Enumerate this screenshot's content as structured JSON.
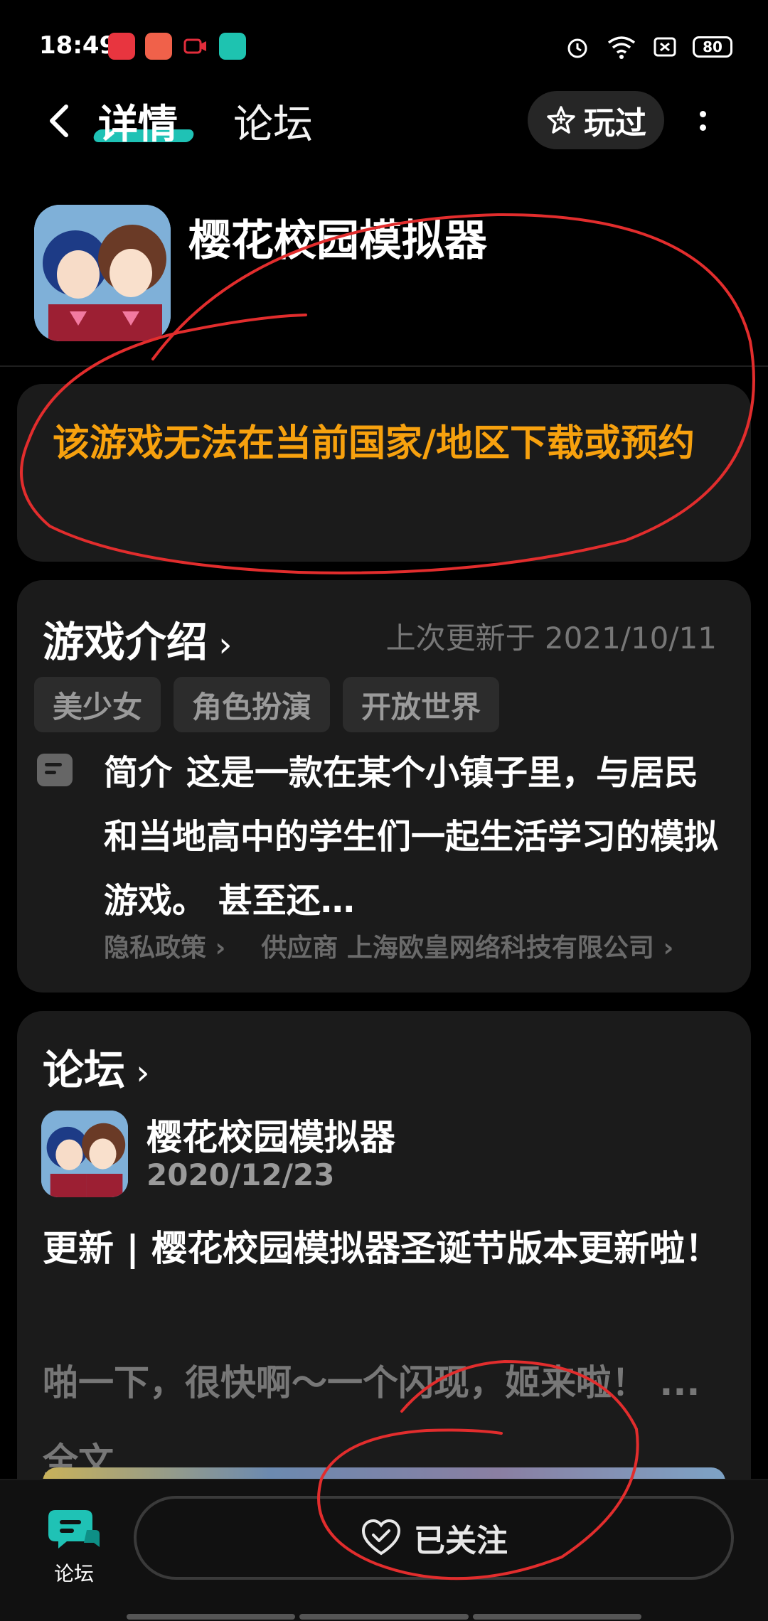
{
  "status_bar": {
    "time": "18:49",
    "battery": "80",
    "app_icon_colors": [
      "#e8353f",
      "#f0614a",
      "#e22d3b",
      "#1ec3b0"
    ]
  },
  "nav": {
    "tab_detail": "详情",
    "tab_forum": "论坛",
    "played_label": "玩过",
    "accent_color": "#1fc2b5"
  },
  "game": {
    "title": "樱花校园模拟器",
    "warning": "该游戏无法在当前国家/地区下载或预约",
    "warning_color": "#f7a10e"
  },
  "intro": {
    "title": "游戏介绍",
    "last_update": "上次更新于  2021/10/11",
    "tags": [
      "美少女",
      "角色扮演",
      "开放世界"
    ],
    "brief_label": "简介",
    "brief_text": "这是一款在某个小镇子里，与居民和当地高中的学生们一起生活学习的模拟游戏。 甚至还…",
    "privacy": "隐私政策 ›",
    "supplier": "供应商  上海欧皇网络科技有限公司 ›"
  },
  "forum": {
    "title": "论坛",
    "post_author": "樱花校园模拟器",
    "post_date": "2020/12/23",
    "post_title": "更新 | 樱花校园模拟器圣诞节版本更新啦！",
    "post_excerpt": "啪一下，很快啊～一个闪现，姬来啦！ ... 全文"
  },
  "bottom": {
    "forum_label": "论坛",
    "follow_label": "已关注"
  }
}
